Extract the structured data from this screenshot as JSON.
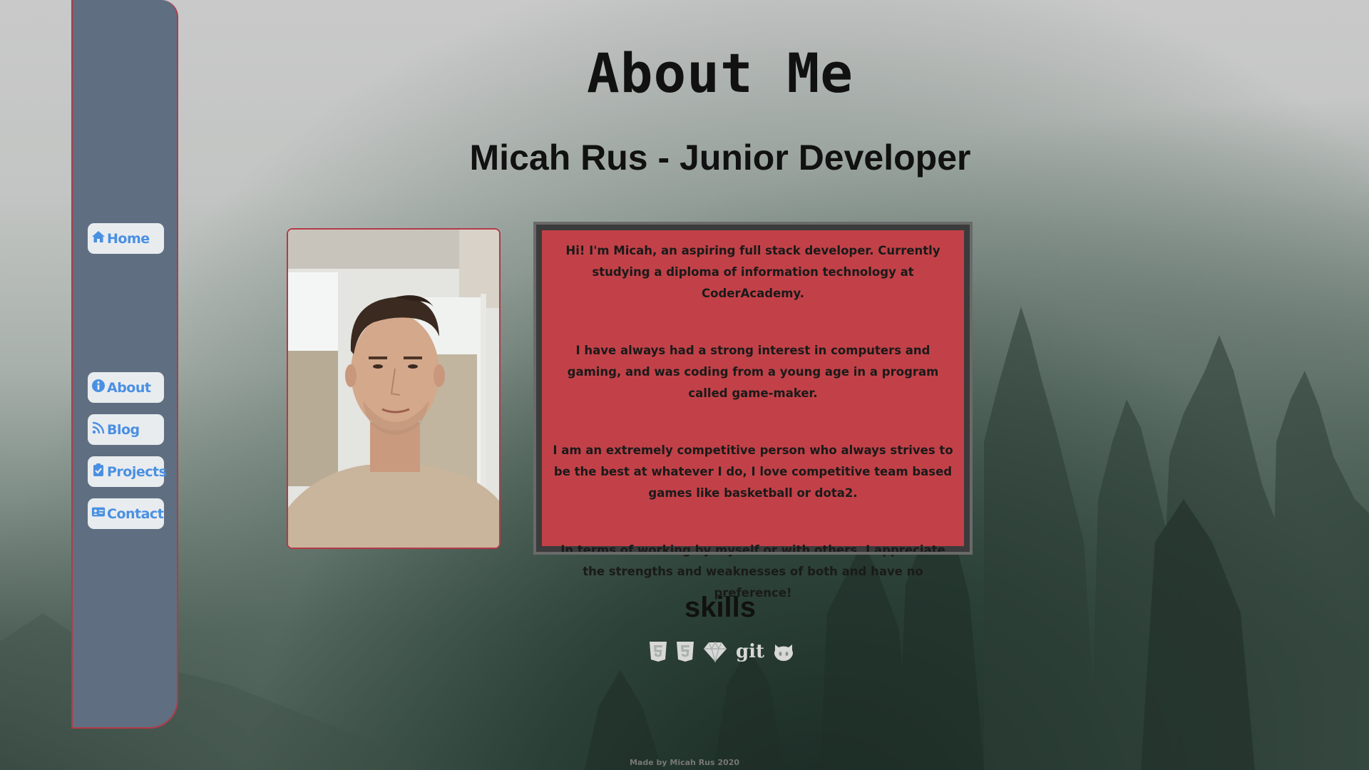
{
  "page": {
    "title": "About Me",
    "subtitle": "Micah Rus - Junior Developer"
  },
  "sidebar": {
    "items": [
      {
        "label": "Home",
        "icon": "home-icon"
      },
      {
        "label": "About",
        "icon": "info-icon"
      },
      {
        "label": "Blog",
        "icon": "rss-icon"
      },
      {
        "label": "Projects",
        "icon": "clipboard-check-icon"
      },
      {
        "label": "Contact",
        "icon": "id-card-icon"
      }
    ]
  },
  "bio": {
    "paragraphs": [
      "Hi! I'm Micah, an aspiring full stack developer. Currently studying a diploma of information technology at CoderAcademy.",
      "I have always had a strong interest in computers and gaming, and was coding from a young age in a program called game-maker.",
      "I am an extremely competitive person who always strives to be the best at whatever I do, I love competitive team based games like basketball or dota2.",
      "In terms of working by myself or with others. I appreciate the strengths and weaknesses of both and have no preference!"
    ]
  },
  "skills": {
    "title": "skills",
    "icons": [
      "html5-icon",
      "css3-icon",
      "sketch-icon",
      "git-icon",
      "github-icon"
    ],
    "git_label": "git"
  },
  "footer": {
    "text": "Made by Micah Rus 2020"
  },
  "colors": {
    "sidebar_bg": "#5f6f81",
    "accent_border": "#b23a48",
    "bio_bg": "#c24148",
    "nav_text": "#4a90e2"
  }
}
